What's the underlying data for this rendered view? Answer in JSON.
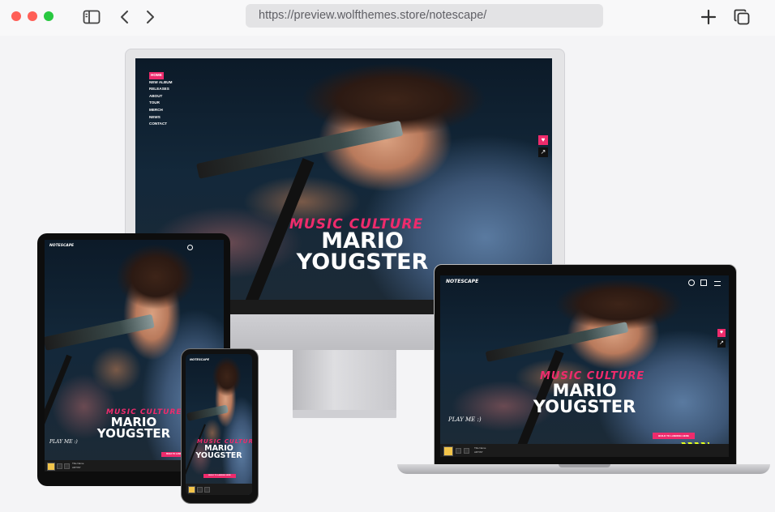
{
  "browser": {
    "url": "https://preview.wolfthemes.store/notescape/",
    "traffic_light_colors": [
      "#ff5f57",
      "#ff5f57",
      "#28c840"
    ],
    "icons": [
      "sidebar-icon",
      "back-icon",
      "forward-icon",
      "new-tab-icon",
      "tabs-icon"
    ]
  },
  "site": {
    "logo": "NOTESCAPE",
    "nav": [
      "HOME",
      "NEW ALBUM",
      "RELEASES",
      "ABOUT",
      "TOUR",
      "MERCH",
      "NEWS",
      "CONTACT"
    ],
    "hero_subtitle": "MUSIC CULTURE",
    "hero_title_line1": "MARIO",
    "hero_title_line2": "YOUGSTER",
    "play_me": "PLAY ME :)",
    "cta": "BUILD TO LANDING HERE",
    "accent_color": "#ee2b6c",
    "track_title": "Title Name",
    "track_artist": "ARTIST"
  }
}
